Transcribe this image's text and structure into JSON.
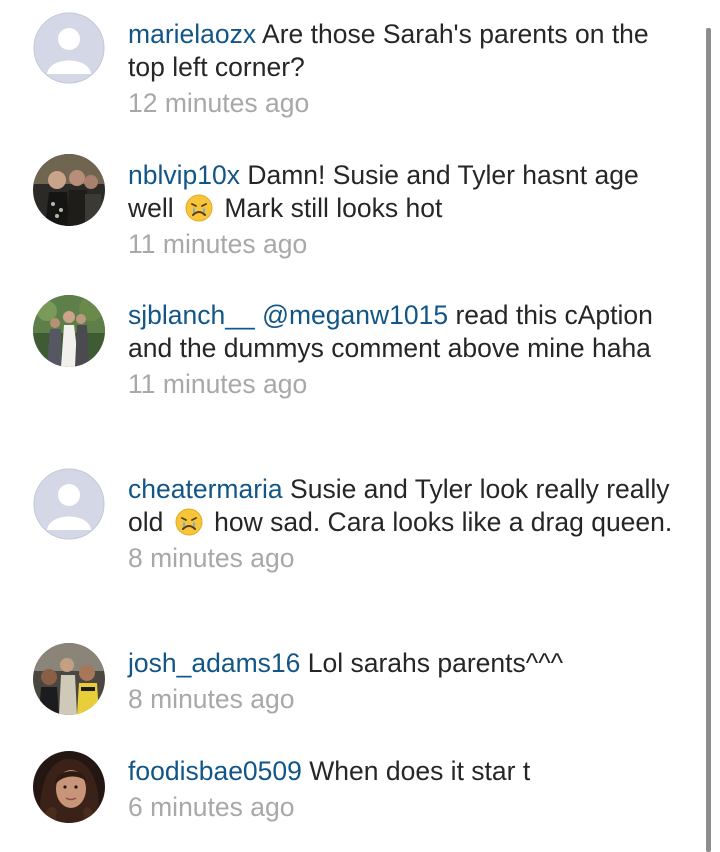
{
  "comments": [
    {
      "username": "marielaozx",
      "text": "Are those Sarah's parents on the top left corner?",
      "time": "12 minutes ago",
      "avatar": "default-avatar"
    },
    {
      "username": "nblvip10x",
      "text_before": "Damn! Susie and Tyler hasnt age well",
      "emoji": "crying-face-emoji",
      "text_after": "Mark still looks hot",
      "time": "11 minutes ago",
      "avatar": "photo-avatar"
    },
    {
      "username": "sjblanch__",
      "mention": "@meganw1015",
      "text": "read this cAption and the dummys comment above mine haha",
      "time": "11 minutes ago",
      "avatar": "photo-avatar"
    },
    {
      "username": "cheatermaria",
      "text_before": "Susie and Tyler look really really old",
      "emoji": "crying-face-emoji",
      "text_after": "how sad. Cara looks like a drag queen.",
      "time": "8 minutes ago",
      "avatar": "default-avatar"
    },
    {
      "username": "josh_adams16",
      "text": "Lol sarahs parents^^^",
      "time": "8 minutes ago",
      "avatar": "photo-avatar"
    },
    {
      "username": "foodisbae0509",
      "text": "When does it star t",
      "time": "6 minutes ago",
      "avatar": "photo-avatar"
    }
  ],
  "colors": {
    "username": "#125688",
    "text": "#262626",
    "timestamp": "#a8a8a8",
    "scrollbar": "#8d8d8d"
  }
}
